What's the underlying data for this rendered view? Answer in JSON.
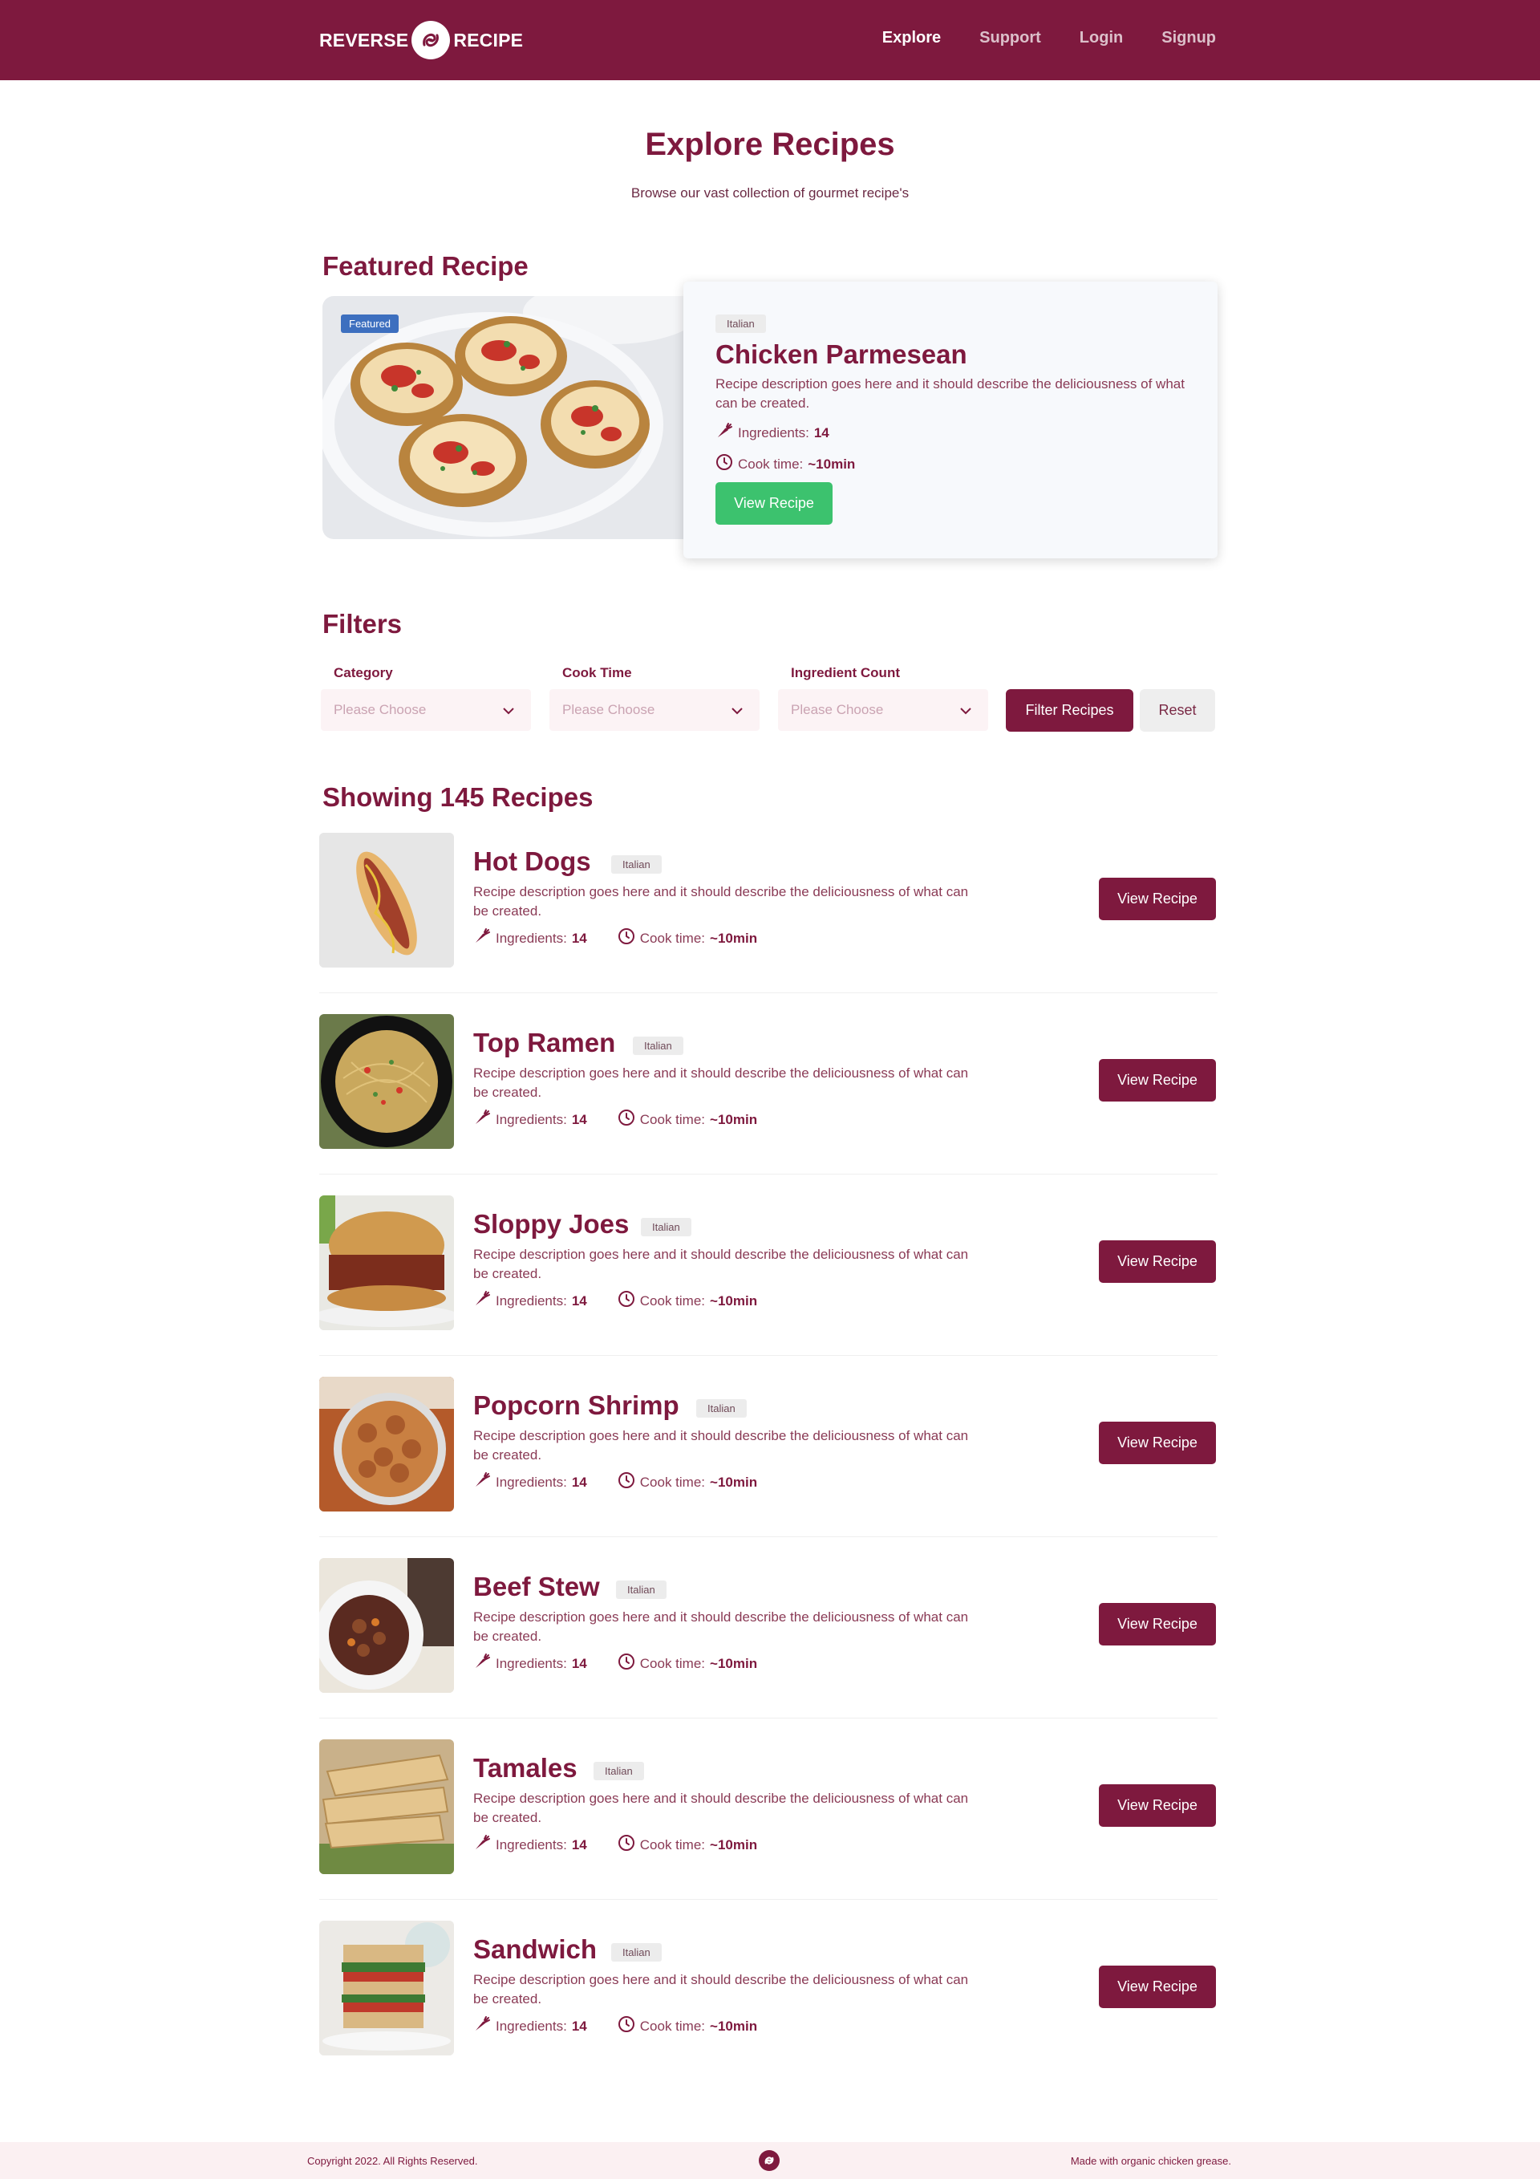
{
  "nav": {
    "logo_left": "REVERSE",
    "logo_right": "RECIPE",
    "links": [
      "Explore",
      "Support",
      "Login",
      "Signup"
    ]
  },
  "hero": {
    "title": "Explore Recipes",
    "subtitle": "Browse our vast collection of gourmet recipe's"
  },
  "featured": {
    "section_title": "Featured Recipe",
    "badge": "Featured",
    "tag": "Italian",
    "title": "Chicken Parmesean",
    "description": "Recipe description goes here and it should describe the deliciousness of what can be created.",
    "ingredients_label": "Ingredients:",
    "ingredients_value": "14",
    "cook_label": "Cook time:",
    "cook_value": "~10min",
    "button": "View Recipe"
  },
  "filters": {
    "section_title": "Filters",
    "category_label": "Category",
    "cook_label": "Cook Time",
    "ingredient_label": "Ingredient Count",
    "placeholder": "Please Choose",
    "filter_button": "Filter Recipes",
    "reset_button": "Reset"
  },
  "results": {
    "title": "Showing 145 Recipes",
    "recipes": [
      {
        "title": "Hot Dogs",
        "tag": "Italian",
        "description": "Recipe description goes here and it should describe the deliciousness of what can be created.",
        "ingredients_label": "Ingredients:",
        "ingredients": "14",
        "cook_label": "Cook time:",
        "cook": "~10min",
        "button": "View Recipe"
      },
      {
        "title": "Top Ramen",
        "tag": "Italian",
        "description": "Recipe description goes here and it should describe the deliciousness of what can be created.",
        "ingredients_label": "Ingredients:",
        "ingredients": "14",
        "cook_label": "Cook time:",
        "cook": "~10min",
        "button": "View Recipe"
      },
      {
        "title": "Sloppy Joes",
        "tag": "Italian",
        "description": "Recipe description goes here and it should describe the deliciousness of what can be created.",
        "ingredients_label": "Ingredients:",
        "ingredients": "14",
        "cook_label": "Cook time:",
        "cook": "~10min",
        "button": "View Recipe"
      },
      {
        "title": "Popcorn Shrimp",
        "tag": "Italian",
        "description": "Recipe description goes here and it should describe the deliciousness of what can be created.",
        "ingredients_label": "Ingredients:",
        "ingredients": "14",
        "cook_label": "Cook time:",
        "cook": "~10min",
        "button": "View Recipe"
      },
      {
        "title": "Beef Stew",
        "tag": "Italian",
        "description": "Recipe description goes here and it should describe the deliciousness of what can be created.",
        "ingredients_label": "Ingredients:",
        "ingredients": "14",
        "cook_label": "Cook time:",
        "cook": "~10min",
        "button": "View Recipe"
      },
      {
        "title": "Tamales",
        "tag": "Italian",
        "description": "Recipe description goes here and it should describe the deliciousness of what can be created.",
        "ingredients_label": "Ingredients:",
        "ingredients": "14",
        "cook_label": "Cook time:",
        "cook": "~10min",
        "button": "View Recipe"
      },
      {
        "title": "Sandwich",
        "tag": "Italian",
        "description": "Recipe description goes here and it should describe the deliciousness of what can be created.",
        "ingredients_label": "Ingredients:",
        "ingredients": "14",
        "cook_label": "Cook time:",
        "cook": "~10min",
        "button": "View Recipe"
      }
    ]
  },
  "footer": {
    "copyright": "Copyright 2022. All Rights Reserved.",
    "tagline": "Made with organic chicken grease."
  },
  "colors": {
    "brand": "#7e193e",
    "success": "#3cc26e",
    "featured_badge": "#3d6fbf"
  },
  "icons": [
    "logo-icon",
    "carrot-icon",
    "clock-icon",
    "chevron-down-icon"
  ]
}
